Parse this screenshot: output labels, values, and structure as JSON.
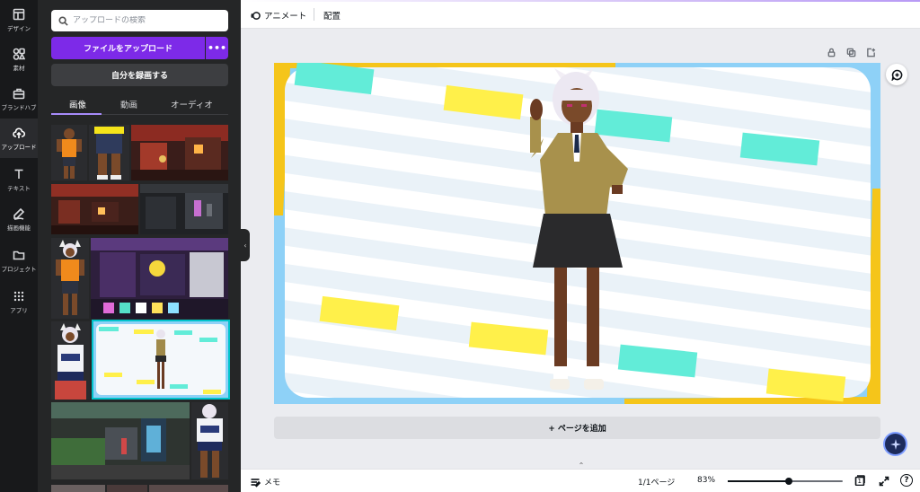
{
  "rail": [
    {
      "id": "design",
      "label": "デザイン",
      "icon": "layout-icon",
      "active": false
    },
    {
      "id": "elements",
      "label": "素材",
      "icon": "shapes-icon",
      "active": false
    },
    {
      "id": "brand",
      "label": "ブランドハブ",
      "icon": "briefcase-icon",
      "active": false
    },
    {
      "id": "uploads",
      "label": "アップロード",
      "icon": "cloud-upload-icon",
      "active": true
    },
    {
      "id": "text",
      "label": "テキスト",
      "icon": "text-icon",
      "active": false
    },
    {
      "id": "draw",
      "label": "描画機能",
      "icon": "pen-icon",
      "active": false
    },
    {
      "id": "projects",
      "label": "プロジェクト",
      "icon": "folder-icon",
      "active": false
    },
    {
      "id": "apps",
      "label": "アプリ",
      "icon": "grid-icon",
      "active": false
    }
  ],
  "panel": {
    "search_placeholder": "アップロードの検索",
    "upload_label": "ファイルをアップロード",
    "more_label": "•••",
    "record_label": "自分を録画する",
    "tabs": [
      {
        "label": "画像",
        "active": true
      },
      {
        "label": "動画",
        "active": false
      },
      {
        "label": "オーディオ",
        "active": false
      }
    ]
  },
  "topbar": {
    "animate_label": "アニメート",
    "position_label": "配置"
  },
  "canvas": {
    "add_page_label": "+ ページを追加"
  },
  "bottombar": {
    "notes_label": "メモ",
    "page_count": "1/1ページ",
    "zoom_label": "83%",
    "zoom_fraction": 0.53,
    "page_number": "1",
    "help_label": "?"
  },
  "colors": {
    "accent": "#7d2ae8",
    "selection": "#00c4cc",
    "rail_bg": "#18191b",
    "panel_bg": "#252627",
    "canvas_bg": "#ebecf0"
  }
}
